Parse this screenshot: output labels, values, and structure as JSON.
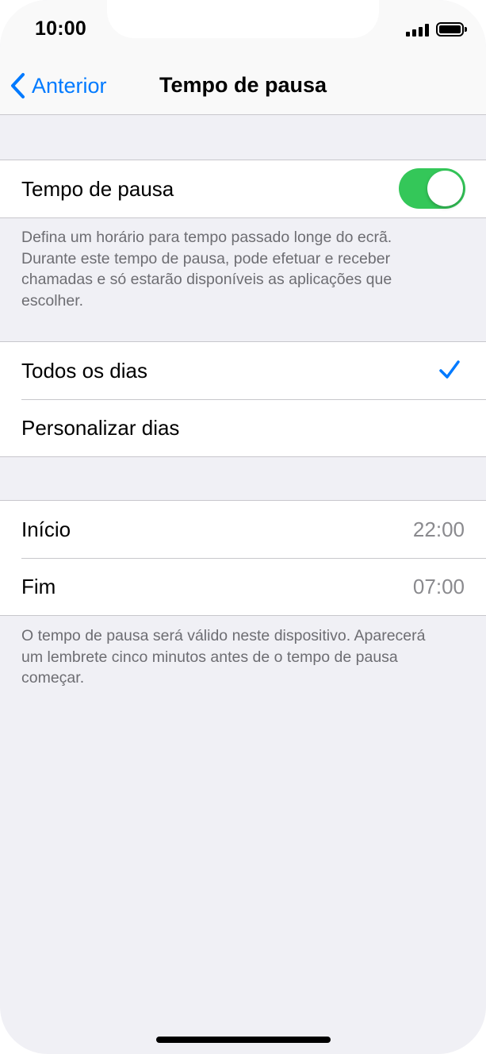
{
  "status_bar": {
    "time": "10:00"
  },
  "nav": {
    "back_label": "Anterior",
    "title": "Tempo de pausa"
  },
  "downtime": {
    "toggle_label": "Tempo de pausa",
    "toggle_on": true,
    "description": "Defina um horário para tempo passado longe do ecrã. Durante este tempo de pausa, pode efetuar e receber chamadas e só estarão disponíveis as aplicações que escolher."
  },
  "days": {
    "items": [
      {
        "label": "Todos os dias",
        "selected": true
      },
      {
        "label": "Personalizar dias",
        "selected": false
      }
    ]
  },
  "schedule": {
    "start_label": "Início",
    "start_value": "22:00",
    "end_label": "Fim",
    "end_value": "07:00",
    "footer": "O tempo de pausa será válido neste dispositivo. Aparecerá um lembrete cinco minutos antes de o tempo de pausa começar."
  },
  "colors": {
    "accent": "#007aff",
    "toggle_on": "#34c759",
    "background": "#f0f0f5"
  }
}
